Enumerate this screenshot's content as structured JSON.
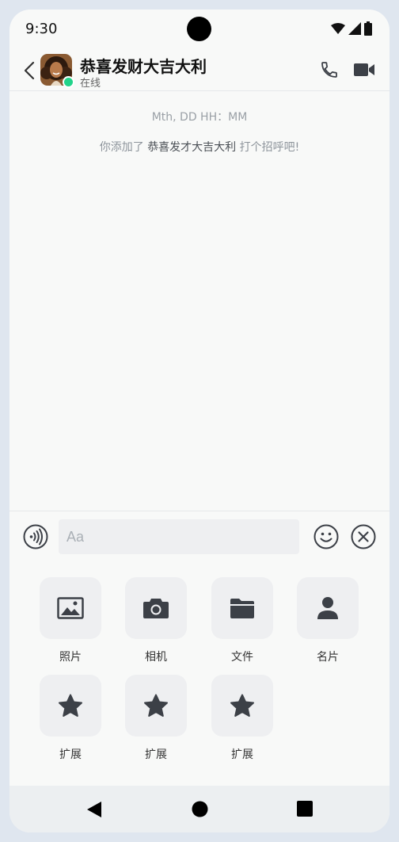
{
  "status_bar": {
    "time": "9:30"
  },
  "header": {
    "contact_name": "恭喜发财大吉大利",
    "presence": "在线"
  },
  "chat": {
    "timestamp": "Mth, DD HH：MM",
    "system_prefix": "你添加了 ",
    "system_name": "恭喜发才大吉大利",
    "system_suffix": " 打个招呼吧!"
  },
  "input": {
    "placeholder": "Aa"
  },
  "panel": {
    "items": [
      {
        "label": "照片",
        "icon": "image-icon"
      },
      {
        "label": "相机",
        "icon": "camera-icon"
      },
      {
        "label": "文件",
        "icon": "folder-icon"
      },
      {
        "label": "名片",
        "icon": "person-icon"
      },
      {
        "label": "扩展",
        "icon": "star-icon"
      },
      {
        "label": "扩展",
        "icon": "star-icon"
      },
      {
        "label": "扩展",
        "icon": "star-icon"
      }
    ]
  },
  "colors": {
    "online": "#22d38a",
    "icon": "#3c4047",
    "tile_bg": "#eeeff1"
  }
}
